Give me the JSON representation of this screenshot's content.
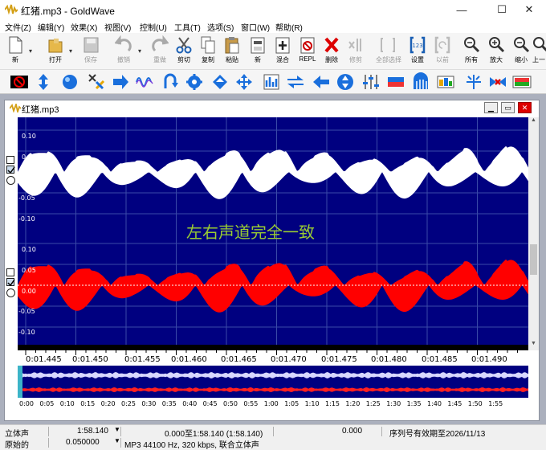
{
  "window": {
    "title": "红猪.mp3 - GoldWave",
    "minimize": "—",
    "maximize": "☐",
    "close": "✕"
  },
  "menu": [
    "文件(Z)",
    "编辑(Y)",
    "效果(X)",
    "视图(V)",
    "控制(U)",
    "工具(T)",
    "选项(S)",
    "窗口(W)",
    "帮助(R)"
  ],
  "toolbar": [
    {
      "label": "新",
      "icon": "new-file-icon",
      "enabled": true
    },
    {
      "label": "打开",
      "icon": "open-folder-icon",
      "enabled": true
    },
    {
      "label": "保存",
      "icon": "save-icon",
      "enabled": false
    },
    {
      "label": "撤销",
      "icon": "undo-icon",
      "enabled": false
    },
    {
      "label": "重做",
      "icon": "redo-icon",
      "enabled": false
    },
    {
      "label": "剪切",
      "icon": "scissors-icon",
      "enabled": true
    },
    {
      "label": "复制",
      "icon": "copy-icon",
      "enabled": true
    },
    {
      "label": "粘贴",
      "icon": "paste-icon",
      "enabled": true
    },
    {
      "label": "新",
      "icon": "paste-new-icon",
      "enabled": true
    },
    {
      "label": "混合",
      "icon": "mix-icon",
      "enabled": true
    },
    {
      "label": "REPL",
      "icon": "replace-icon",
      "enabled": true
    },
    {
      "label": "删除",
      "icon": "delete-icon",
      "enabled": true
    },
    {
      "label": "修剪",
      "icon": "trim-icon",
      "enabled": false
    },
    {
      "label": "全部选择",
      "icon": "select-all-icon",
      "enabled": false
    },
    {
      "label": "设置",
      "icon": "set-marker-icon",
      "enabled": true
    },
    {
      "label": "以前",
      "icon": "previous-icon",
      "enabled": false
    },
    {
      "label": "所有",
      "icon": "zoom-all-icon",
      "enabled": true
    },
    {
      "label": "放大",
      "icon": "zoom-in-icon",
      "enabled": true
    },
    {
      "label": "缩小",
      "icon": "zoom-out-icon",
      "enabled": true
    },
    {
      "label": "上一",
      "icon": "zoom-previous-icon",
      "enabled": true
    }
  ],
  "effects_icons": [
    "no-entry-icon",
    "resample-icon",
    "doppler-icon",
    "channel-mixer-icon",
    "compressor-icon",
    "echo-icon",
    "reverse-icon",
    "time-warp-icon",
    "noise-reduction-icon",
    "color-wheel-icon",
    "dynamics-icon",
    "equalizer-icon",
    "flip-channels-icon",
    "pan-left-icon",
    "invert-icon",
    "sliders-icon",
    "fade-icon",
    "filter-icon",
    "spectrum-icon",
    "pop-click-icon",
    "volume-icon",
    "wave-icon"
  ],
  "document": {
    "title": "红猪.mp3"
  },
  "axis": {
    "left_ticks": [
      "0.10",
      "0.05",
      "0.00",
      "-0.05",
      "-0.10"
    ],
    "right_ticks": [
      "0.10",
      "0.05",
      "0.00",
      "-0.05",
      "-0.10"
    ]
  },
  "annotation": "左右声道完全一致",
  "timeline": [
    "0:01.445",
    "0:01.450",
    "0:01.455",
    "0:01.460",
    "0:01.465",
    "0:01.470",
    "0:01.475",
    "0:01.480",
    "0:01.485",
    "0:01.490"
  ],
  "overview_ticks": [
    "0:00",
    "0:05",
    "0:10",
    "0:15",
    "0:20",
    "0:25",
    "0:30",
    "0:35",
    "0:40",
    "0:45",
    "0:50",
    "0:55",
    "1:00",
    "1:05",
    "1:10",
    "1:15",
    "1:20",
    "1:25",
    "1:30",
    "1:35",
    "1:40",
    "1:45",
    "1:50",
    "1:55"
  ],
  "colors": {
    "background": "#000080",
    "left_channel": "#ffffff",
    "right_channel": "#ff0000",
    "annotation": "#9acd32"
  },
  "status": {
    "channels": "立体声",
    "length": "1:58.140",
    "selection": "0.000至1:58.140 (1:58.140)",
    "position": "0.000",
    "license": "序列号有效期至2026/11/13",
    "mode": "原始的",
    "zoom": "0.050000",
    "format": "MP3 44100 Hz, 320 kbps, 联合立体声"
  }
}
